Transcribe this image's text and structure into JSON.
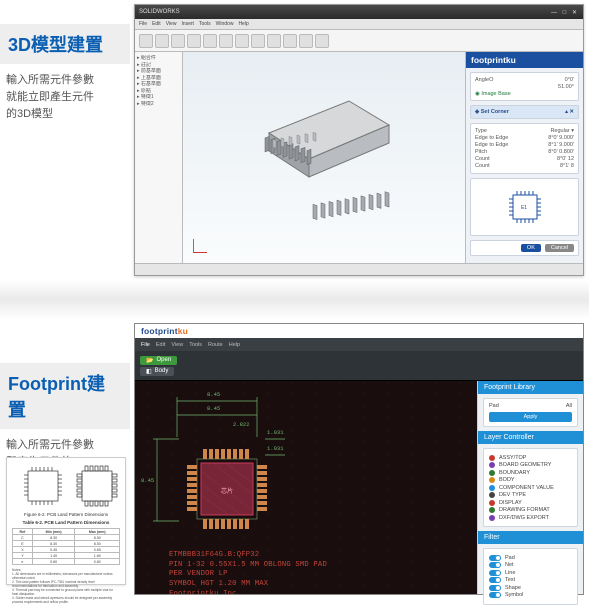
{
  "sections": {
    "top": {
      "title": "3D模型建置",
      "subtitle_l1": "輸入所需元件參數",
      "subtitle_l2": "就能立即產生元件",
      "subtitle_l3": "的3D模型"
    },
    "bottom": {
      "title": "Footprint建置",
      "subtitle_l1": "輸入所需元件參數",
      "subtitle_l2": "即產生元件的Footprint"
    }
  },
  "solidworks": {
    "titlebar": "SOLIDWORKS",
    "menus": [
      "File",
      "Edit",
      "View",
      "Insert",
      "Tools",
      "Window",
      "Help"
    ],
    "tree": [
      "▸ 組合件",
      "  ▸ 註記",
      "  ▸ 前基準面",
      "  ▸ 上基準面",
      "  ▸ 右基準面",
      "  ▸ 原點",
      "  ▸ 特徵1",
      "  ▸ 特徵2"
    ],
    "side": {
      "brand": "footprintku",
      "angle_label": "AngleO",
      "angle_values": [
        "0°0'",
        "51.00°"
      ],
      "image_toggle": "Image Base",
      "panel_header": "Set Corner",
      "rows": [
        {
          "k": "Type",
          "v": "Regular ▾"
        },
        {
          "k": "Edge to Edge",
          "v": "8°0'  9.000'"
        },
        {
          "k": "Edge to Edge",
          "v": "8°1'  9.000'"
        },
        {
          "k": "Pitch",
          "v": "8°0'  0.800'"
        },
        {
          "k": "Count",
          "v": "8°0'  12"
        },
        {
          "k": "Count",
          "v": "8°1'  8"
        }
      ],
      "e1": "E1",
      "buttons": [
        "OK",
        "Cancel"
      ]
    }
  },
  "footprintku": {
    "brand_a": "footprint",
    "brand_b": "ku",
    "tabs": [
      "File",
      "Edit",
      "View",
      "Tools",
      "Route",
      "Help"
    ],
    "chip_open": "Open",
    "chip_body": "Body",
    "right": {
      "panel1": "Footprint Library",
      "pad_label": "Pad",
      "pad_value": "All",
      "apply": "Apply",
      "panel2": "Layer Controller",
      "layers": [
        {
          "name": "ASSY/TOP",
          "color": "#c63b2e"
        },
        {
          "name": "BOARD GEOMETRY",
          "color": "#7a3fae"
        },
        {
          "name": "BOUNDARY",
          "color": "#2f7a2f"
        },
        {
          "name": "BODY",
          "color": "#d78a1a"
        },
        {
          "name": "COMPONENT VALUE",
          "color": "#1f8fd6"
        },
        {
          "name": "DEV TYPE",
          "color": "#444"
        },
        {
          "name": "DISPLAY",
          "color": "#c63b2e"
        },
        {
          "name": "DRAWING FORMAT",
          "color": "#2f7a2f"
        },
        {
          "name": "DXF/DWG EXPORT",
          "color": "#7a3fae"
        }
      ],
      "panel3": "Filter",
      "filters": [
        "Pad",
        "Net",
        "Line",
        "Text",
        "Shape",
        "Symbol"
      ]
    },
    "annotations": {
      "d1": "8.45",
      "d2": "8.45",
      "d3": "1.031",
      "d4": "1.031",
      "d5": "8.45",
      "d6": "2.822"
    },
    "textblock_l1": "ETMBBB31F64G.B:QFP32",
    "textblock_l2": "PIN 1-32 0.55X1.5 MM OBLONG SMD PAD",
    "textblock_l3": "PER VENDOR LP",
    "textblock_l4": "SYMBOL HGT 1.20 MM MAX",
    "textblock_l5": "Footprintku Inc."
  },
  "drawing": {
    "caption": "Figure 6-2. PCB Land Pattern Dimensions",
    "table_caption": "Table 6-2. PCB Land Pattern Dimensions",
    "headers": [
      "Ref",
      "Min (mm)",
      "Max (mm)"
    ],
    "rows": [
      [
        "C",
        "8.30",
        "8.50"
      ],
      [
        "E",
        "8.30",
        "8.50"
      ],
      [
        "X",
        "0.45",
        "0.65"
      ],
      [
        "Y",
        "1.40",
        "1.60"
      ],
      [
        "e",
        "0.80",
        "0.80"
      ]
    ],
    "notes_l1": "Notes:",
    "notes_l2": "1. All dimensions are in millimeters; tolerances per manufacturer unless otherwise noted.",
    "notes_l3": "2. This land pattern follows IPC-7351 nominal density level recommendations for fabrication and assembly.",
    "notes_l4": "3. Thermal pad may be connected to ground plane with multiple vias for heat dissipation.",
    "notes_l5": "4. Solder mask and stencil apertures should be designed per assembly process requirements and reflow profile."
  }
}
